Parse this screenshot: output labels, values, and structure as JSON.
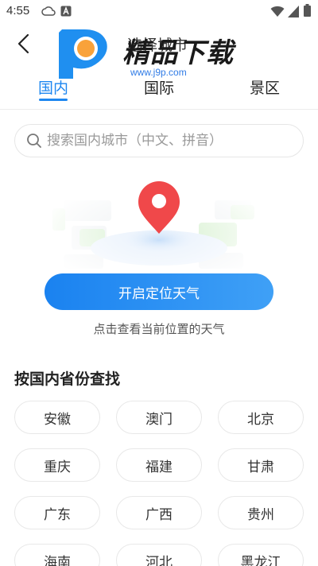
{
  "status_bar": {
    "time": "4:55"
  },
  "header": {
    "page_title": "选择城市",
    "watermark": {
      "title": "精品下载",
      "url": "www.j9p.com"
    },
    "tabs": [
      {
        "label": "国内",
        "active": true
      },
      {
        "label": "国际",
        "active": false
      },
      {
        "label": "景区",
        "active": false
      }
    ]
  },
  "search": {
    "placeholder": "搜索国内城市（中文、拼音）"
  },
  "locate": {
    "button_label": "开启定位天气",
    "hint": "点击查看当前位置的天气"
  },
  "provinces": {
    "title": "按国内省份查找",
    "items": [
      "安徽",
      "澳门",
      "北京",
      "重庆",
      "福建",
      "甘肃",
      "广东",
      "广西",
      "贵州",
      "海南",
      "河北",
      "黑龙江"
    ]
  },
  "colors": {
    "accent": "#1e87f0",
    "pin": "#f0484a",
    "map_green": "#d6f0cf"
  }
}
